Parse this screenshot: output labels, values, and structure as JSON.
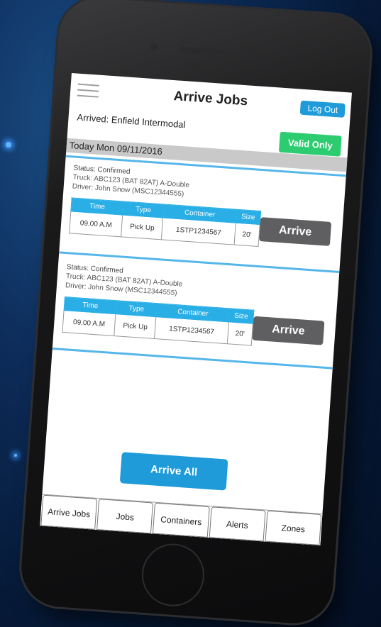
{
  "header": {
    "title": "Arrive Jobs",
    "logout_label": "Log Out"
  },
  "arrived": "Arrived: Enfield Intermodal",
  "valid_only_label": "Valid Only",
  "date_header": "Today Mon 09/11/2016",
  "table_headers": [
    "Time",
    "Type",
    "Container",
    "Size"
  ],
  "jobs": [
    {
      "status": "Status: Confirmed",
      "truck": "Truck: ABC123 (BAT 82AT) A-Double",
      "driver": "Driver: John Snow (MSC12344555)",
      "time": "09.00 A.M",
      "type": "Pick Up",
      "container": "1STP1234567",
      "size": "20'",
      "arrive_label": "Arrive"
    },
    {
      "status": "Status: Confirmed",
      "truck": "Truck: ABC123 (BAT 82AT) A-Double",
      "driver": "Driver: John Snow (MSC12344555)",
      "time": "09.00 A.M",
      "type": "Pick Up",
      "container": "1STP1234567",
      "size": "20'",
      "arrive_label": "Arrive"
    }
  ],
  "arrive_all_label": "Arrive All",
  "tabs": [
    "Arrive Jobs",
    "Jobs",
    "Containers",
    "Alerts",
    "Zones"
  ]
}
